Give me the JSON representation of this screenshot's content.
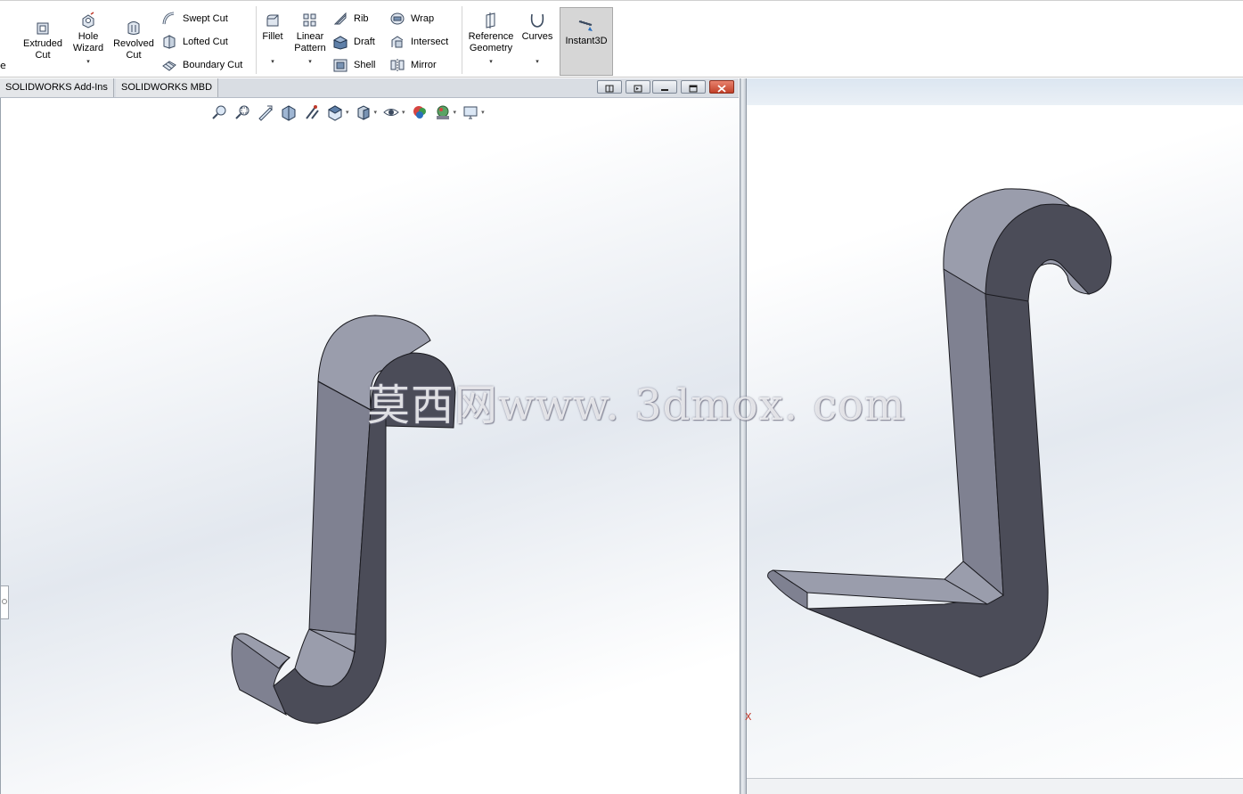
{
  "ribbon": {
    "left_edge_text": "e",
    "extruded_cut": "Extruded\nCut",
    "hole_wizard": "Hole\nWizard",
    "revolved_cut": "Revolved\nCut",
    "swept_cut": "Swept Cut",
    "lofted_cut": "Lofted Cut",
    "boundary_cut": "Boundary Cut",
    "fillet": "Fillet",
    "linear_pattern": "Linear\nPattern",
    "rib": "Rib",
    "draft": "Draft",
    "shell": "Shell",
    "wrap": "Wrap",
    "intersect": "Intersect",
    "mirror": "Mirror",
    "reference_geometry": "Reference\nGeometry",
    "curves": "Curves",
    "instant3d": "Instant3D",
    "dropdown_glyph": "▾"
  },
  "tabs": [
    {
      "label": "SOLIDWORKS Add-Ins"
    },
    {
      "label": "SOLIDWORKS MBD"
    }
  ],
  "watermark": "莫西网www. 3dmox. com",
  "triad_label": "X",
  "colors": {
    "model_side": "#7f8191",
    "model_top": "#9a9dac",
    "model_face": "#4b4c58",
    "edge": "#1a1a1f",
    "ribbon_active": "#d6d6d6",
    "close_button": "#c94b33"
  },
  "icons": [
    "extruded-cut-icon",
    "hole-wizard-icon",
    "revolved-cut-icon",
    "swept-cut-icon",
    "lofted-cut-icon",
    "boundary-cut-icon",
    "fillet-icon",
    "linear-pattern-icon",
    "rib-icon",
    "draft-icon",
    "shell-icon",
    "wrap-icon",
    "intersect-icon",
    "mirror-icon",
    "reference-geometry-icon",
    "curves-icon",
    "instant3d-icon",
    "zoom-to-fit-icon",
    "zoom-area-icon",
    "previous-view-icon",
    "section-view-icon",
    "dynamic-annotation-icon",
    "view-orientation-icon",
    "display-style-icon",
    "hide-show-icon",
    "edit-appearance-icon",
    "apply-scene-icon",
    "view-settings-icon"
  ]
}
